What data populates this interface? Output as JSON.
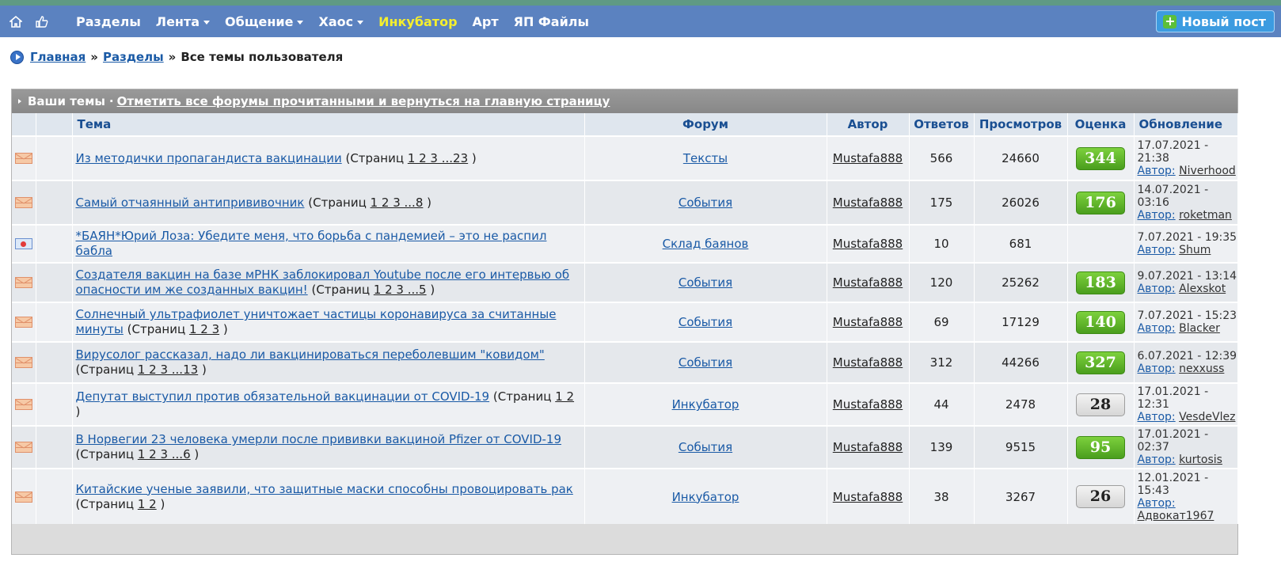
{
  "nav": {
    "items": [
      {
        "label": "Разделы",
        "dropdown": false,
        "highlight": false
      },
      {
        "label": "Лента",
        "dropdown": true,
        "highlight": false
      },
      {
        "label": "Общение",
        "dropdown": true,
        "highlight": false
      },
      {
        "label": "Хаос",
        "dropdown": true,
        "highlight": false
      },
      {
        "label": "Инкубатор",
        "dropdown": false,
        "highlight": true
      },
      {
        "label": "Арт",
        "dropdown": false,
        "highlight": false
      },
      {
        "label": "ЯП Файлы",
        "dropdown": false,
        "highlight": false
      }
    ],
    "new_post": "Новый пост"
  },
  "breadcrumb": {
    "home": "Главная",
    "sep": "»",
    "sections": "Разделы",
    "current": "Все темы пользователя"
  },
  "panel": {
    "title": "Ваши темы",
    "dot": "·",
    "mark_read_link": "Отметить все форумы прочитанными и вернуться на главную страницу"
  },
  "columns": {
    "topic": "Тема",
    "forum": "Форум",
    "author": "Автор",
    "replies": "Ответов",
    "views": "Просмотров",
    "rating": "Оценка",
    "updated": "Обновление"
  },
  "labels": {
    "pages_open": "(Страниц",
    "pages_close": ")",
    "author_prefix": "Автор:"
  },
  "colors": {
    "nav_bg": "#5b82c0",
    "nav_highlight": "#f5ef2d",
    "link": "#1a5aa6",
    "score_green": "#5cb02a"
  },
  "topics": [
    {
      "icon": "envelope",
      "title": "Из методички пропагандиста вакцинации",
      "pages": "1 2 3 ...23",
      "forum": "Тексты",
      "author": "Mustafa888",
      "replies": "566",
      "views": "24660",
      "score": "344",
      "score_style": "green",
      "updated": "17.07.2021 - 21:38",
      "updated_by": "Niverhood"
    },
    {
      "icon": "envelope",
      "title": "Самый отчаянный антипрививочник",
      "pages": "1 2 3 ...8",
      "forum": "События",
      "author": "Mustafa888",
      "replies": "175",
      "views": "26026",
      "score": "176",
      "score_style": "green",
      "updated": "14.07.2021 - 03:16",
      "updated_by": "roketman"
    },
    {
      "icon": "calendar",
      "title": "*БАЯН*Юрий Лоза: Убедите меня, что борьба с пандемией – это не распил бабла",
      "pages": "",
      "forum": "Склад баянов",
      "author": "Mustafa888",
      "replies": "10",
      "views": "681",
      "score": "",
      "score_style": "none",
      "updated": "7.07.2021 - 19:35",
      "updated_by": "Shum"
    },
    {
      "icon": "envelope",
      "title": "Создателя вакцин на базе мРНК заблокировал Youtube после его интервью об опасности им же созданных вакцин!",
      "pages": "1 2 3 ...5",
      "forum": "События",
      "author": "Mustafa888",
      "replies": "120",
      "views": "25262",
      "score": "183",
      "score_style": "green",
      "updated": "9.07.2021 - 13:14",
      "updated_by": "Alexskot"
    },
    {
      "icon": "envelope",
      "title": "Солнечный ультрафиолет уничтожает частицы коронавируса за считанные минуты",
      "pages": "1 2 3",
      "forum": "События",
      "author": "Mustafa888",
      "replies": "69",
      "views": "17129",
      "score": "140",
      "score_style": "green",
      "updated": "7.07.2021 - 15:23",
      "updated_by": "Blacker"
    },
    {
      "icon": "envelope",
      "title": "Вирусолог рассказал, надо ли вакцинироваться переболевшим \"ковидом\"",
      "pages": "1 2 3 ...13",
      "forum": "События",
      "author": "Mustafa888",
      "replies": "312",
      "views": "44266",
      "score": "327",
      "score_style": "green",
      "updated": "6.07.2021 - 12:39",
      "updated_by": "nexxuss"
    },
    {
      "icon": "envelope",
      "title": "Депутат выступил против обязательной вакцинации от COVID-19",
      "pages": "1 2",
      "forum": "Инкубатор",
      "author": "Mustafa888",
      "replies": "44",
      "views": "2478",
      "score": "28",
      "score_style": "neutral",
      "updated": "17.01.2021 - 12:31",
      "updated_by": "VesdeVlez"
    },
    {
      "icon": "envelope",
      "title": "В Норвегии 23 человека умерли после прививки вакциной Pfizer от COVID-19",
      "pages": "1 2 3 ...6",
      "forum": "События",
      "author": "Mustafa888",
      "replies": "139",
      "views": "9515",
      "score": "95",
      "score_style": "green",
      "updated": "17.01.2021 - 02:37",
      "updated_by": "kurtosis"
    },
    {
      "icon": "envelope",
      "title": "Китайские ученые заявили, что защитные маски способны провоцировать рак",
      "pages": "1 2",
      "forum": "Инкубатор",
      "author": "Mustafa888",
      "replies": "38",
      "views": "3267",
      "score": "26",
      "score_style": "neutral",
      "updated": "12.01.2021 - 15:43",
      "updated_by": "Адвокат1967"
    }
  ]
}
